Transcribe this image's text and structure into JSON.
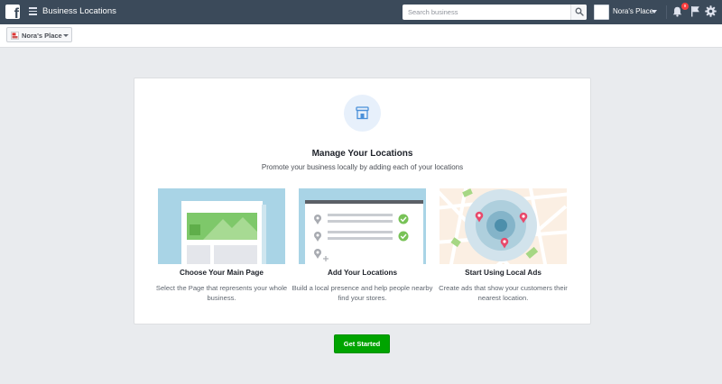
{
  "topbar": {
    "title": "Business Locations",
    "search_placeholder": "Search business",
    "profile_name": "Nora's Place",
    "notification_count": "9"
  },
  "subbar": {
    "page_selector": "Nora's Place"
  },
  "card": {
    "title": "Manage Your Locations",
    "subtitle": "Promote your business locally by adding each of your locations",
    "features": [
      {
        "title": "Choose Your Main Page",
        "description": "Select the Page that represents your whole business."
      },
      {
        "title": "Add Your Locations",
        "description": "Build a local presence and help people nearby find your stores."
      },
      {
        "title": "Start Using Local Ads",
        "description": "Create ads that show your customers their nearest location."
      }
    ]
  },
  "cta": {
    "label": "Get Started"
  },
  "colors": {
    "topbar": "#3b4a5a",
    "accent_green": "#00a400",
    "illustration_blue": "#a9d4e6",
    "marker_pink": "#e8496b",
    "check_green": "#78c257"
  },
  "icons": [
    "facebook-logo-icon",
    "hamburger-icon",
    "search-icon",
    "bell-icon",
    "flag-icon",
    "gear-icon",
    "store-icon",
    "map-pin-icon",
    "checkmark-icon"
  ]
}
